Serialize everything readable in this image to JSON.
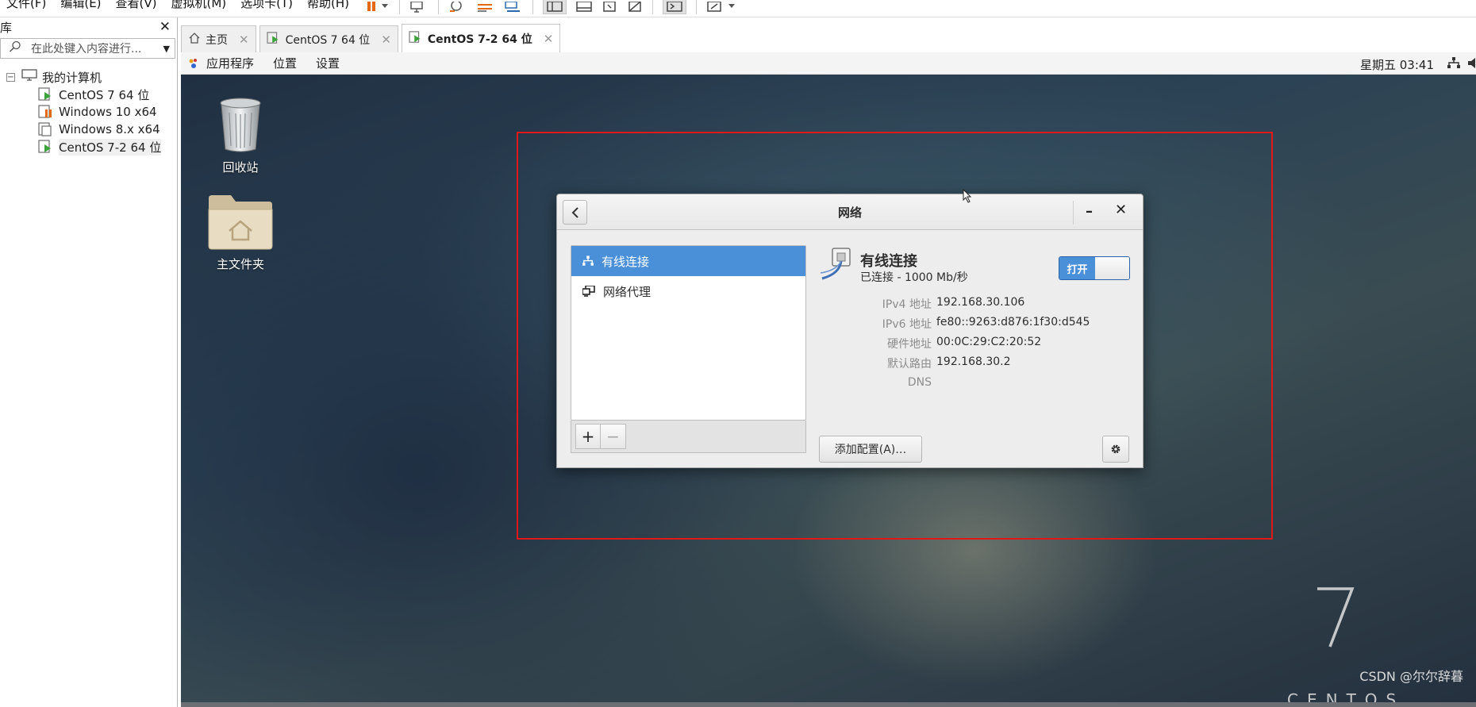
{
  "menubar": {
    "items": [
      "文件(F)",
      "编辑(E)",
      "查看(V)",
      "虚拟机(M)",
      "选项卡(T)",
      "帮助(H)"
    ]
  },
  "library": {
    "title": "库",
    "search_placeholder": "在此处键入内容进行...",
    "tree": {
      "root": "我的计算机",
      "items": [
        "CentOS 7 64 位",
        "Windows 10 x64",
        "Windows 8.x x64",
        "CentOS 7-2 64 位"
      ]
    }
  },
  "tabs": [
    {
      "label": "主页"
    },
    {
      "label": "CentOS 7 64 位"
    },
    {
      "label": "CentOS 7-2 64 位"
    }
  ],
  "guest_panel": {
    "menus": [
      "应用程序",
      "位置",
      "设置"
    ],
    "clock": "星期五 03:41"
  },
  "desktop": {
    "icons": [
      "回收站",
      "主文件夹"
    ],
    "brand_number": "7",
    "brand_word": "CENTOS",
    "watermark": "CSDN @尔尔辞暮"
  },
  "dialog": {
    "title": "网络",
    "list": [
      "有线连接",
      "网络代理"
    ],
    "connection": {
      "name": "有线连接",
      "status": "已连接 - 1000 Mb/秒",
      "toggle_label": "打开",
      "properties": [
        {
          "key": "IPv4 地址",
          "value": "192.168.30.106"
        },
        {
          "key": "IPv6 地址",
          "value": "fe80::9263:d876:1f30:d545"
        },
        {
          "key": "硬件地址",
          "value": "00:0C:29:C2:20:52"
        },
        {
          "key": "默认路由",
          "value": "192.168.30.2"
        },
        {
          "key": "DNS",
          "value": ""
        }
      ]
    },
    "add_profile_label": "添加配置(A)…"
  },
  "colors": {
    "selection": "#4a90d9",
    "highlight_box": "#e01818",
    "vm_running": "#3aa33a",
    "vm_paused": "#e36a12"
  }
}
